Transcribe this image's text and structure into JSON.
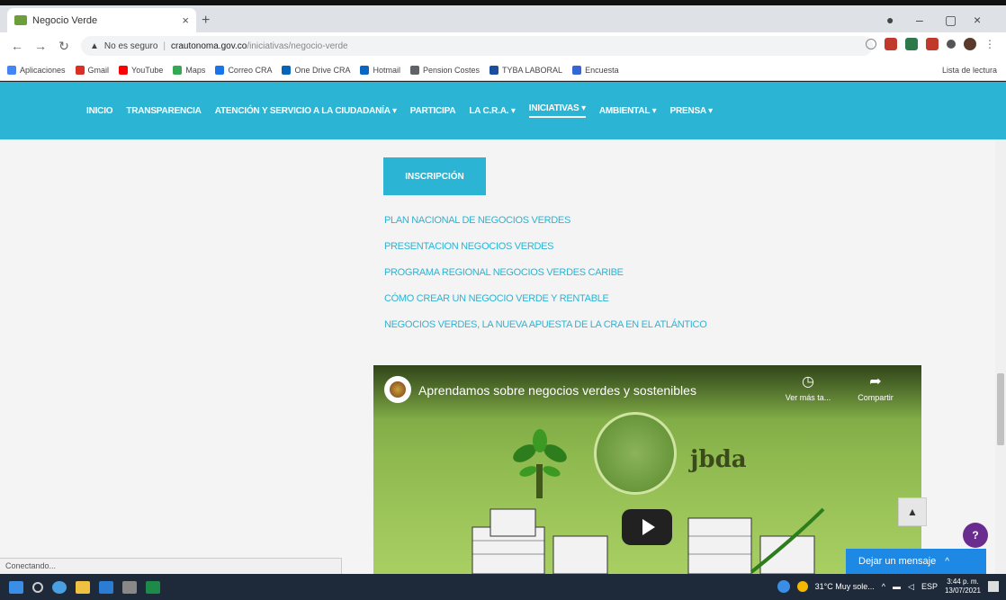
{
  "browser": {
    "tab_title": "Negocio Verde",
    "tab_close": "×",
    "new_tab": "+",
    "win_minimize": "–",
    "win_maximize": "▢",
    "win_close": "×",
    "address": {
      "security_label": "No es seguro",
      "host": "crautonoma.gov.co",
      "path": "/iniciativas/negocio-verde"
    },
    "bookmarks": [
      {
        "label": "Aplicaciones",
        "color": "#4285f4"
      },
      {
        "label": "Gmail",
        "color": "#d93025"
      },
      {
        "label": "YouTube",
        "color": "#ff0000"
      },
      {
        "label": "Maps",
        "color": "#34a853"
      },
      {
        "label": "Correo CRA",
        "color": "#1a73e8"
      },
      {
        "label": "One Drive CRA",
        "color": "#0364b8"
      },
      {
        "label": "Hotmail",
        "color": "#0a66c2"
      },
      {
        "label": "Pension Costes",
        "color": "#5f6368"
      },
      {
        "label": "TYBA LABORAL",
        "color": "#1a4fa0"
      },
      {
        "label": "Encuesta",
        "color": "#3367d6"
      }
    ],
    "reading_list": "Lista de lectura"
  },
  "site_nav": {
    "items": [
      {
        "label": "INICIO"
      },
      {
        "label": "TRANSPARENCIA"
      },
      {
        "label": "ATENCIÓN Y SERVICIO A LA CIUDADANÍA ▾"
      },
      {
        "label": "PARTICIPA"
      },
      {
        "label": "LA C.R.A. ▾"
      },
      {
        "label": "INICIATIVAS ▾"
      },
      {
        "label": "AMBIENTAL ▾"
      },
      {
        "label": "PRENSA ▾"
      }
    ]
  },
  "content": {
    "inscripcion_label": "INSCRIPCIÓN",
    "links": [
      "PLAN NACIONAL DE NEGOCIOS VERDES",
      "PRESENTACION NEGOCIOS VERDES",
      "PROGRAMA REGIONAL NEGOCIOS VERDES CARIBE",
      "CÓMO CREAR UN NEGOCIO VERDE Y RENTABLE",
      "NEGOCIOS VERDES, LA NUEVA APUESTA DE LA CRA EN EL ATLÁNTICO"
    ]
  },
  "video": {
    "title": "Aprendamos sobre negocios verdes y sostenibles",
    "watch_later": "Ver más ta...",
    "share": "Compartir",
    "logo_text": "jbda"
  },
  "widgets": {
    "help_count": "?",
    "chat_label": "Dejar un mensaje",
    "status_text": "Conectando..."
  },
  "taskbar": {
    "weather": "31°C Muy sole...",
    "lang": "ESP",
    "time": "3:44 p. m.",
    "date": "13/07/2021"
  }
}
